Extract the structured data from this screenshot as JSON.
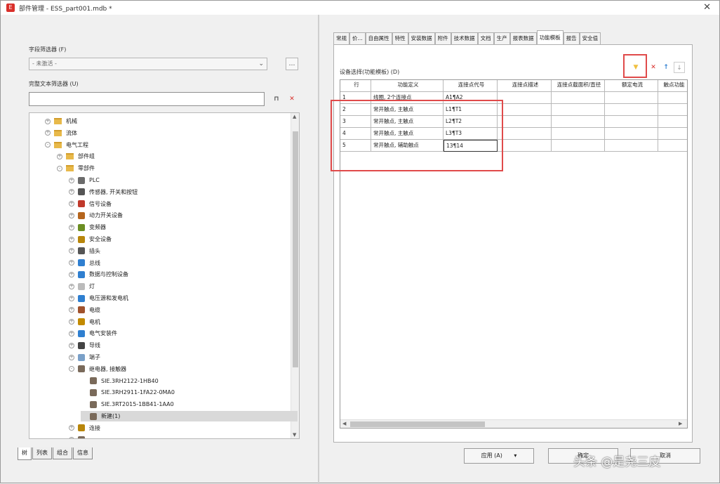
{
  "window": {
    "title": "部件管理 - ESS_part001.mdb *"
  },
  "left": {
    "field_filter_label": "字段筛选器 (F)",
    "field_filter_value": "- 未激活 -",
    "text_filter_label": "完整文本筛选器 (U)",
    "text_filter_value": "",
    "tree": [
      {
        "label": "机械",
        "indent": 0,
        "exp": "+",
        "icon": "folder"
      },
      {
        "label": "流体",
        "indent": 0,
        "exp": "+",
        "icon": "folder"
      },
      {
        "label": "电气工程",
        "indent": 0,
        "exp": "-",
        "icon": "folder"
      },
      {
        "label": "部件组",
        "indent": 1,
        "exp": "+",
        "icon": "folder"
      },
      {
        "label": "零部件",
        "indent": 1,
        "exp": "-",
        "icon": "folder"
      },
      {
        "label": "PLC",
        "indent": 2,
        "exp": "+",
        "icon": "plc"
      },
      {
        "label": "传感器, 开关和按钮",
        "indent": 2,
        "exp": "+",
        "icon": "sensor"
      },
      {
        "label": "信号设备",
        "indent": 2,
        "exp": "+",
        "icon": "signal"
      },
      {
        "label": "动力开关设备",
        "indent": 2,
        "exp": "+",
        "icon": "power"
      },
      {
        "label": "变频器",
        "indent": 2,
        "exp": "+",
        "icon": "vfd"
      },
      {
        "label": "安全设备",
        "indent": 2,
        "exp": "+",
        "icon": "safety"
      },
      {
        "label": "插头",
        "indent": 2,
        "exp": "+",
        "icon": "plug"
      },
      {
        "label": "总线",
        "indent": 2,
        "exp": "+",
        "icon": "bus"
      },
      {
        "label": "数据与控制设备",
        "indent": 2,
        "exp": "+",
        "icon": "data"
      },
      {
        "label": "灯",
        "indent": 2,
        "exp": "+",
        "icon": "lamp"
      },
      {
        "label": "电压源和发电机",
        "indent": 2,
        "exp": "+",
        "icon": "voltage"
      },
      {
        "label": "电缆",
        "indent": 2,
        "exp": "+",
        "icon": "cable"
      },
      {
        "label": "电机",
        "indent": 2,
        "exp": "+",
        "icon": "motor"
      },
      {
        "label": "电气安装件",
        "indent": 2,
        "exp": "+",
        "icon": "install"
      },
      {
        "label": "导线",
        "indent": 2,
        "exp": "+",
        "icon": "wire"
      },
      {
        "label": "端子",
        "indent": 2,
        "exp": "+",
        "icon": "terminal"
      },
      {
        "label": "继电器, 接触器",
        "indent": 2,
        "exp": "-",
        "icon": "relay"
      },
      {
        "label": "SIE.3RH2122-1HB40",
        "indent": 3,
        "exp": "",
        "icon": "relay"
      },
      {
        "label": "SIE.3RH2911-1FA22-0MA0",
        "indent": 3,
        "exp": "",
        "icon": "relay"
      },
      {
        "label": "SIE.3RT2015-1BB41-1AA0",
        "indent": 3,
        "exp": "",
        "icon": "relay"
      },
      {
        "label": "新建(1)",
        "indent": 3,
        "exp": "",
        "icon": "relay",
        "selected": true
      },
      {
        "label": "连接",
        "indent": 2,
        "exp": "+",
        "icon": "conn"
      },
      {
        "label": "...",
        "indent": 2,
        "exp": "+",
        "icon": "relay"
      }
    ],
    "bottom_tabs": [
      "树",
      "列表",
      "组合",
      "信息"
    ]
  },
  "right": {
    "tabs": [
      "常规",
      "价...",
      "自由属性",
      "特性",
      "安装数据",
      "附件",
      "技术数据",
      "文档",
      "生产",
      "报表数据",
      "功能模板",
      "报告",
      "安全值"
    ],
    "active_tab": "功能模板",
    "grid_label": "设备选择(功能模板) (D)",
    "columns": [
      "行",
      "功能定义",
      "连接点代号",
      "连接点描述",
      "连接点截面积/直径",
      "额定电流",
      "触点功能"
    ],
    "rows": [
      [
        "1",
        "线圈, 2个连接点",
        "A1¶A2",
        "",
        "",
        "",
        ""
      ],
      [
        "2",
        "常开触点, 主触点",
        "L1¶T1",
        "",
        "",
        "",
        ""
      ],
      [
        "3",
        "常开触点, 主触点",
        "L2¶T2",
        "",
        "",
        "",
        ""
      ],
      [
        "4",
        "常开触点, 主触点",
        "L3¶T3",
        "",
        "",
        "",
        ""
      ],
      [
        "5",
        "常开触点, 辅助触点",
        "13¶14",
        "",
        "",
        "",
        ""
      ]
    ],
    "buttons": {
      "apply": "应用 (A)",
      "ok": "确定",
      "cancel": "取消"
    }
  },
  "colors": {
    "highlight_box": "#e04a4a",
    "filter_button": "#f0c040",
    "delete": "#d9302b",
    "arrow": "#2f7fd0"
  },
  "watermark": "头条 @是尧三皮"
}
